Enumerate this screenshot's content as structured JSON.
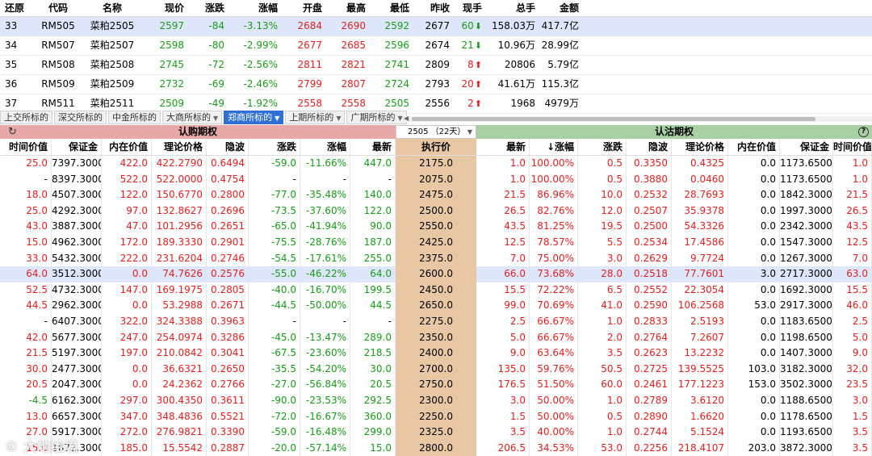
{
  "quotes": {
    "headers": [
      "还原",
      "代码",
      "名称",
      "现价",
      "涨跌",
      "涨幅",
      "开盘",
      "最高",
      "最低",
      "昨收",
      "现手",
      "总手",
      "金额"
    ],
    "rows": [
      {
        "idx": "33",
        "code": "RM505",
        "name": "菜粕2505",
        "price": "2597",
        "chg": "-84",
        "pct": "-3.13%",
        "open": "2684",
        "high": "2690",
        "low": "2592",
        "prev": "2677",
        "vol": "60",
        "dir": "down",
        "total": "158.03万",
        "amount": "417.7亿",
        "selected": true
      },
      {
        "idx": "34",
        "code": "RM507",
        "name": "菜粕2507",
        "price": "2598",
        "chg": "-80",
        "pct": "-2.99%",
        "open": "2677",
        "high": "2685",
        "low": "2596",
        "prev": "2674",
        "vol": "21",
        "dir": "down",
        "total": "10.96万",
        "amount": "28.99亿",
        "selected": false
      },
      {
        "idx": "35",
        "code": "RM508",
        "name": "菜粕2508",
        "price": "2745",
        "chg": "-72",
        "pct": "-2.56%",
        "open": "2811",
        "high": "2821",
        "low": "2741",
        "prev": "2809",
        "vol": "8",
        "dir": "up",
        "total": "20806",
        "amount": "5.79亿",
        "selected": false
      },
      {
        "idx": "36",
        "code": "RM509",
        "name": "菜粕2509",
        "price": "2732",
        "chg": "-69",
        "pct": "-2.46%",
        "open": "2799",
        "high": "2807",
        "low": "2724",
        "prev": "2793",
        "vol": "20",
        "dir": "up",
        "total": "41.61万",
        "amount": "115.3亿",
        "selected": false
      },
      {
        "idx": "37",
        "code": "RM511",
        "name": "菜粕2511",
        "price": "2509",
        "chg": "-49",
        "pct": "-1.92%",
        "open": "2558",
        "high": "2558",
        "low": "2505",
        "prev": "2556",
        "vol": "2",
        "dir": "up",
        "total": "1968",
        "amount": "4979万",
        "selected": false
      }
    ]
  },
  "tabs": [
    {
      "label": "上交所标的",
      "dropdown": false,
      "active": false
    },
    {
      "label": "深交所标的",
      "dropdown": false,
      "active": false
    },
    {
      "label": "中金所标的",
      "dropdown": false,
      "active": false
    },
    {
      "label": "大商所标的",
      "dropdown": true,
      "active": false
    },
    {
      "label": "郑商所标的",
      "dropdown": true,
      "active": true
    },
    {
      "label": "上期所标的",
      "dropdown": true,
      "active": false
    },
    {
      "label": "广期所标的",
      "dropdown": true,
      "active": false
    }
  ],
  "options": {
    "call_title": "认购期权",
    "put_title": "认沽期权",
    "expiry": "2505 （22天）",
    "headers": [
      "时间价值",
      "保证金",
      "内在价值",
      "理论价格",
      "隐波",
      "涨跌",
      "涨幅",
      "最新",
      "执行价",
      "最新",
      "↓涨幅",
      "涨跌",
      "隐波",
      "理论价格",
      "内在价值",
      "保证金",
      "时间价值"
    ],
    "rows": [
      {
        "c": [
          "25.0",
          "7397.3000",
          "422.0",
          "422.2790",
          "0.6494",
          "-59.0",
          "-11.66%",
          "447.0"
        ],
        "k": "2175.0",
        "p": [
          "1.0",
          "100.00%",
          "0.5",
          "0.3350",
          "0.4325",
          "0.0",
          "1173.6500",
          "1.0"
        ]
      },
      {
        "c": [
          "-",
          "8397.3000",
          "522.0",
          "522.0000",
          "0.4754",
          "-",
          "-",
          "-"
        ],
        "k": "2075.0",
        "p": [
          "1.0",
          "100.00%",
          "0.5",
          "0.3880",
          "0.0460",
          "0.0",
          "1173.6500",
          "1.0"
        ]
      },
      {
        "c": [
          "18.0",
          "4507.3000",
          "122.0",
          "150.6770",
          "0.2800",
          "-77.0",
          "-35.48%",
          "140.0"
        ],
        "k": "2475.0",
        "p": [
          "21.5",
          "86.96%",
          "10.0",
          "0.2532",
          "28.7693",
          "0.0",
          "1842.3000",
          "21.5"
        ]
      },
      {
        "c": [
          "25.0",
          "4292.3000",
          "97.0",
          "132.8627",
          "0.2696",
          "-73.5",
          "-37.60%",
          "122.0"
        ],
        "k": "2500.0",
        "p": [
          "26.5",
          "82.76%",
          "12.0",
          "0.2507",
          "35.9378",
          "0.0",
          "1997.3000",
          "26.5"
        ]
      },
      {
        "c": [
          "43.0",
          "3887.3000",
          "47.0",
          "101.2956",
          "0.2651",
          "-65.0",
          "-41.94%",
          "90.0"
        ],
        "k": "2550.0",
        "p": [
          "43.5",
          "81.25%",
          "19.5",
          "0.2500",
          "54.3326",
          "0.0",
          "2342.3000",
          "43.5"
        ]
      },
      {
        "c": [
          "15.0",
          "4962.3000",
          "172.0",
          "189.3330",
          "0.2901",
          "-75.5",
          "-28.76%",
          "187.0"
        ],
        "k": "2425.0",
        "p": [
          "12.5",
          "78.57%",
          "5.5",
          "0.2534",
          "17.4586",
          "0.0",
          "1547.3000",
          "12.5"
        ]
      },
      {
        "c": [
          "33.0",
          "5432.3000",
          "222.0",
          "231.6204",
          "0.2746",
          "-54.5",
          "-17.61%",
          "255.0"
        ],
        "k": "2375.0",
        "p": [
          "7.0",
          "75.00%",
          "3.0",
          "0.2629",
          "9.7724",
          "0.0",
          "1267.3000",
          "7.0"
        ]
      },
      {
        "c": [
          "64.0",
          "3512.3000",
          "0.0",
          "74.7626",
          "0.2576",
          "-55.0",
          "-46.22%",
          "64.0"
        ],
        "k": "2600.0",
        "p": [
          "66.0",
          "73.68%",
          "28.0",
          "0.2518",
          "77.7601",
          "3.0",
          "2717.3000",
          "63.0"
        ],
        "sel": true
      },
      {
        "c": [
          "52.5",
          "4732.3000",
          "147.0",
          "169.1975",
          "0.2805",
          "-40.0",
          "-16.70%",
          "199.5"
        ],
        "k": "2450.0",
        "p": [
          "15.5",
          "72.22%",
          "6.5",
          "0.2552",
          "22.3054",
          "0.0",
          "1692.3000",
          "15.5"
        ]
      },
      {
        "c": [
          "44.5",
          "2962.3000",
          "0.0",
          "53.2988",
          "0.2671",
          "-44.5",
          "-50.00%",
          "44.5"
        ],
        "k": "2650.0",
        "p": [
          "99.0",
          "70.69%",
          "41.0",
          "0.2590",
          "106.2568",
          "53.0",
          "2917.3000",
          "46.0"
        ]
      },
      {
        "c": [
          "-",
          "6407.3000",
          "322.0",
          "324.3388",
          "0.3963",
          "-",
          "-",
          "-"
        ],
        "k": "2275.0",
        "p": [
          "2.5",
          "66.67%",
          "1.0",
          "0.2833",
          "2.5193",
          "0.0",
          "1183.6500",
          "2.5"
        ]
      },
      {
        "c": [
          "42.0",
          "5677.3000",
          "247.0",
          "254.0974",
          "0.3286",
          "-45.0",
          "-13.47%",
          "289.0"
        ],
        "k": "2350.0",
        "p": [
          "5.0",
          "66.67%",
          "2.0",
          "0.2764",
          "7.2607",
          "0.0",
          "1198.6500",
          "5.0"
        ]
      },
      {
        "c": [
          "21.5",
          "5197.3000",
          "197.0",
          "210.0842",
          "0.3041",
          "-67.5",
          "-23.60%",
          "218.5"
        ],
        "k": "2400.0",
        "p": [
          "9.0",
          "63.64%",
          "3.5",
          "0.2623",
          "13.2232",
          "0.0",
          "1407.3000",
          "9.0"
        ]
      },
      {
        "c": [
          "30.0",
          "2477.3000",
          "0.0",
          "36.6321",
          "0.2650",
          "-35.5",
          "-54.20%",
          "30.0"
        ],
        "k": "2700.0",
        "p": [
          "135.0",
          "59.76%",
          "50.5",
          "0.2725",
          "139.5525",
          "103.0",
          "3182.3000",
          "32.0"
        ]
      },
      {
        "c": [
          "20.5",
          "2047.3000",
          "0.0",
          "24.2362",
          "0.2766",
          "-27.0",
          "-56.84%",
          "20.5"
        ],
        "k": "2750.0",
        "p": [
          "176.5",
          "51.50%",
          "60.0",
          "0.2461",
          "177.1223",
          "153.0",
          "3502.3000",
          "23.5"
        ]
      },
      {
        "c": [
          "-4.5",
          "6162.3000",
          "297.0",
          "300.4350",
          "0.3611",
          "-90.0",
          "-23.53%",
          "292.5"
        ],
        "k": "2300.0",
        "p": [
          "3.0",
          "50.00%",
          "1.0",
          "0.2789",
          "3.6120",
          "0.0",
          "1188.6500",
          "3.0"
        ]
      },
      {
        "c": [
          "13.0",
          "6657.3000",
          "347.0",
          "348.4836",
          "0.5521",
          "-72.0",
          "-16.67%",
          "360.0"
        ],
        "k": "2250.0",
        "p": [
          "1.5",
          "50.00%",
          "0.5",
          "0.2890",
          "1.6620",
          "0.0",
          "1178.6500",
          "1.5"
        ]
      },
      {
        "c": [
          "27.0",
          "5917.3000",
          "272.0",
          "276.9821",
          "0.3390",
          "-59.0",
          "-16.48%",
          "299.0"
        ],
        "k": "2325.0",
        "p": [
          "3.5",
          "40.00%",
          "1.0",
          "0.2744",
          "5.1524",
          "0.0",
          "1193.6500",
          "3.5"
        ]
      },
      {
        "c": [
          "15.0",
          "1672.3000",
          "185.0",
          "15.5542",
          "0.2887",
          "-20.0",
          "-57.14%",
          "15.0"
        ],
        "k": "2800.0",
        "p": [
          "206.5",
          "34.53%",
          "53.0",
          "0.2256",
          "218.4107",
          "203.0",
          "3872.3000",
          "3.5"
        ]
      }
    ]
  },
  "watermark": "© 大地绘境",
  "colors": {
    "call_bar": "#e7a8a8",
    "put_bar": "#a8d0a4",
    "strike_col": "#e8c7a4",
    "selected_row": "#dde6fb",
    "up": "#e02020",
    "down": "#1a9a1a",
    "tab_active": "#2f6fd6"
  }
}
